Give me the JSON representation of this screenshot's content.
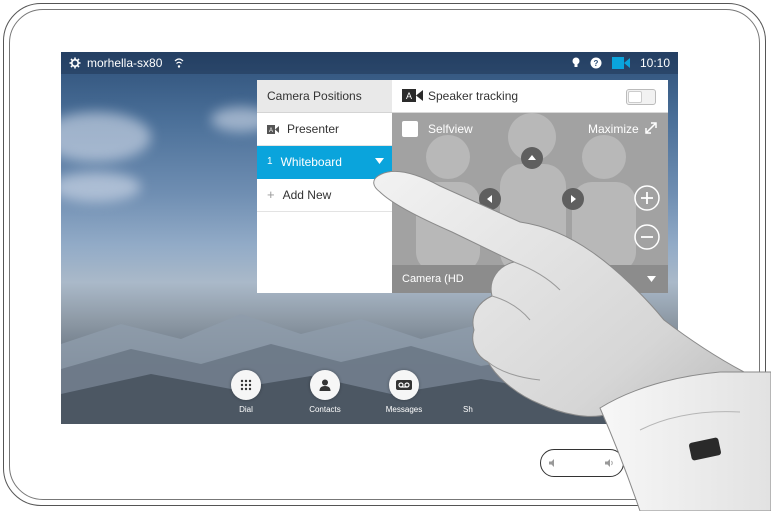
{
  "status_bar": {
    "device_name": "morhella-sx80",
    "time": "10:10",
    "icons": [
      "gear-icon",
      "wifi-icon",
      "lightbulb-icon",
      "help-icon",
      "camera-icon"
    ]
  },
  "camera_positions": {
    "header": "Camera Positions",
    "items": [
      {
        "index": "",
        "label": "Presenter",
        "icon": "presenter-camera-icon",
        "selected": false
      },
      {
        "index": "1",
        "label": "Whiteboard",
        "icon": "dropdown-caret-icon",
        "selected": true
      },
      {
        "index": "+",
        "label": "Add New",
        "icon": "plus-icon",
        "selected": false
      }
    ]
  },
  "camera_panel": {
    "speaker_tracking_label": "Speaker tracking",
    "speaker_tracking_badge": "A",
    "speaker_tracking_on": false,
    "selfview_label": "Selfview",
    "maximize_label": "Maximize",
    "camera_select_label": "Camera (HD"
  },
  "dock": {
    "items": [
      {
        "label": "Dial",
        "icon": "dialpad-icon"
      },
      {
        "label": "Contacts",
        "icon": "person-icon"
      },
      {
        "label": "Messages",
        "icon": "voicemail-icon"
      },
      {
        "label": "Sh",
        "icon": "share-icon"
      }
    ]
  },
  "colors": {
    "accent": "#0aa4dc",
    "panel_gray": "#a2a2a2"
  }
}
